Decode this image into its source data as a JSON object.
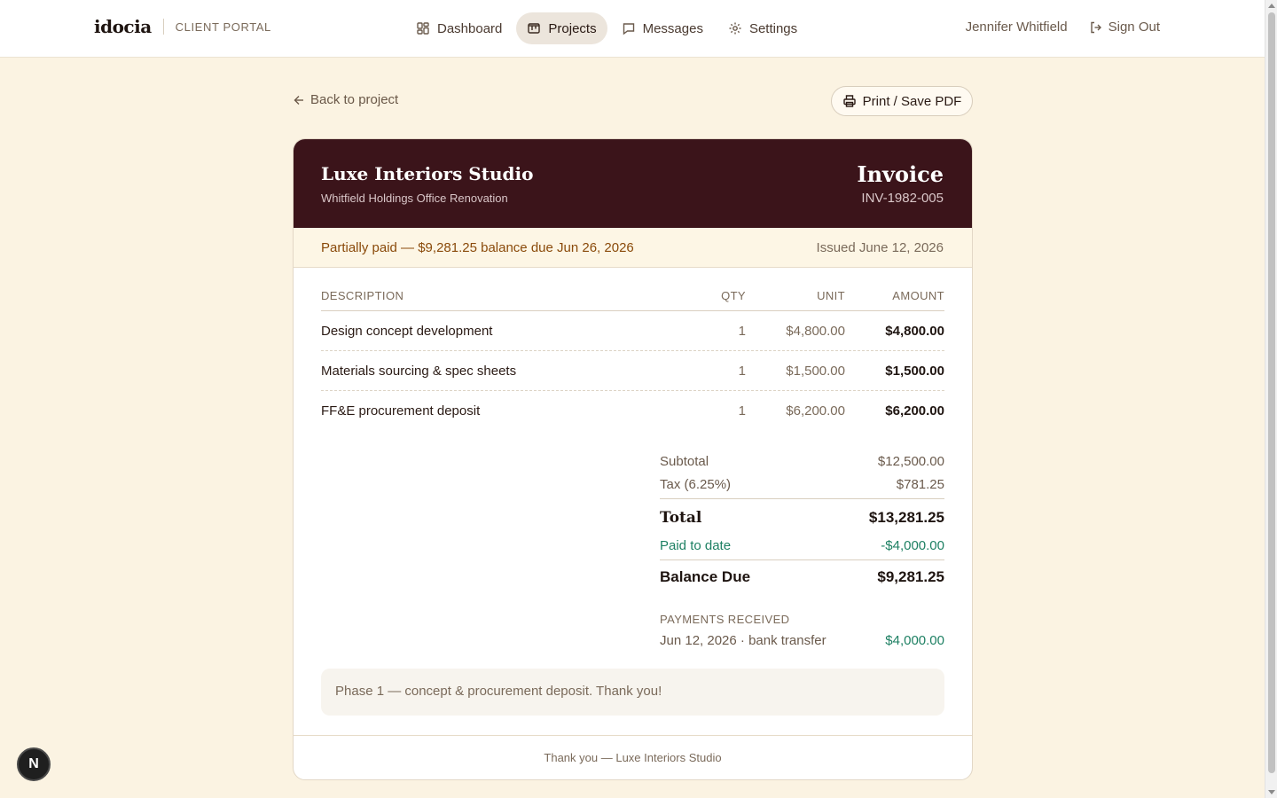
{
  "brand": {
    "logo": "idocia",
    "portal_label": "CLIENT PORTAL"
  },
  "nav": {
    "dashboard": "Dashboard",
    "projects": "Projects",
    "messages": "Messages",
    "settings": "Settings"
  },
  "user": {
    "name": "Jennifer Whitfield",
    "signout": "Sign Out"
  },
  "actions": {
    "back": "Back to project",
    "print": "Print / Save PDF"
  },
  "invoice": {
    "studio": "Luxe Interiors Studio",
    "project": "Whitfield Holdings Office Renovation",
    "title": "Invoice",
    "number": "INV-1982-005",
    "status": "Partially paid — $9,281.25 balance due Jun 26, 2026",
    "issued": "Issued June 12, 2026",
    "columns": {
      "desc": "DESCRIPTION",
      "qty": "QTY",
      "unit": "UNIT",
      "amount": "AMOUNT"
    },
    "items": [
      {
        "desc": "Design concept development",
        "qty": "1",
        "unit": "$4,800.00",
        "amount": "$4,800.00"
      },
      {
        "desc": "Materials sourcing & spec sheets",
        "qty": "1",
        "unit": "$1,500.00",
        "amount": "$1,500.00"
      },
      {
        "desc": "FF&E procurement deposit",
        "qty": "1",
        "unit": "$6,200.00",
        "amount": "$6,200.00"
      }
    ],
    "totals": {
      "subtotal_label": "Subtotal",
      "subtotal": "$12,500.00",
      "tax_label": "Tax (6.25%)",
      "tax": "$781.25",
      "total_label": "Total",
      "total": "$13,281.25",
      "paid_label": "Paid to date",
      "paid": "-$4,000.00",
      "due_label": "Balance Due",
      "due": "$9,281.25"
    },
    "payments_heading": "PAYMENTS RECEIVED",
    "payments": [
      {
        "desc": "Jun 12, 2026 · bank transfer",
        "amount": "$4,000.00"
      }
    ],
    "note": "Phase 1 — concept & procurement deposit. Thank you!",
    "footer": "Thank you — Luxe Interiors Studio"
  },
  "fab": {
    "label": "N"
  },
  "colors": {
    "header_bg": "#3b141a",
    "page_bg": "#fbf3e2",
    "status_text": "#8a4a0a",
    "paid_green": "#1e8063"
  }
}
